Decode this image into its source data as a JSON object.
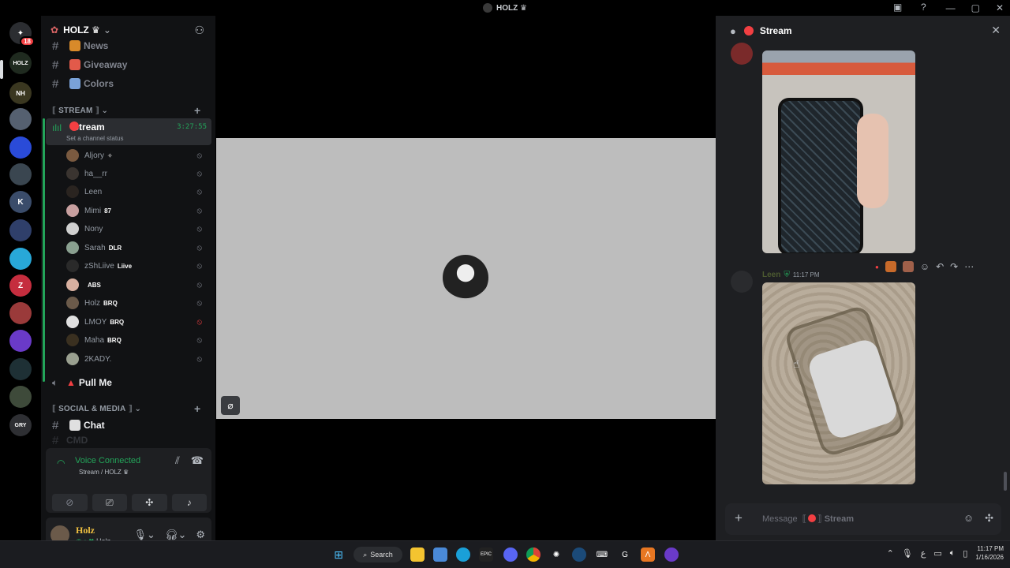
{
  "window": {
    "title": "HOLZ ♛",
    "controls": [
      "—",
      "▢",
      "✕"
    ]
  },
  "rail": {
    "home_badge": "18",
    "servers": [
      {
        "name": "discord-home",
        "label": "✦",
        "color": "#2b2d31"
      },
      {
        "name": "holz",
        "label": "HOLZ",
        "color": "#1f2a1f"
      },
      {
        "name": "nh",
        "label": "NH",
        "color": "#3a3720"
      },
      {
        "name": "server-3",
        "label": "",
        "color": "#556070"
      },
      {
        "name": "server-4",
        "label": "",
        "color": "#2a4bd8"
      },
      {
        "name": "server-5",
        "label": "",
        "color": "#3a4650"
      },
      {
        "name": "server-6",
        "label": "K",
        "color": "#3a4c6a"
      },
      {
        "name": "server-7",
        "label": "",
        "color": "#2f3f6a"
      },
      {
        "name": "server-8",
        "label": "",
        "color": "#28a8d8"
      },
      {
        "name": "server-9",
        "label": "Z",
        "color": "#c52d3e"
      },
      {
        "name": "server-10",
        "label": "",
        "color": "#9a3a3a"
      },
      {
        "name": "server-11",
        "label": "",
        "color": "#6a3ac8"
      },
      {
        "name": "server-12",
        "label": "",
        "color": "#1e3035"
      },
      {
        "name": "server-13",
        "label": "",
        "color": "#3e4a3a"
      },
      {
        "name": "server-14",
        "label": "GRY",
        "color": "#2e2f33"
      }
    ]
  },
  "guild": {
    "name": "HOLZ ♛",
    "channels_top": [
      {
        "label": "News"
      },
      {
        "label": "Giveaway"
      },
      {
        "label": "Colors"
      }
    ],
    "category_stream": "STREAM",
    "voice_channel": {
      "name": "Stream",
      "status": "Set a channel status",
      "time": "3:27:55"
    },
    "voice_users": [
      {
        "name": "Aljory",
        "tag": "✧"
      },
      {
        "name": "ha__rr",
        "tag": ""
      },
      {
        "name": "Leen",
        "tag": ""
      },
      {
        "name": "Mimi",
        "tag": "87"
      },
      {
        "name": "Nony",
        "tag": ""
      },
      {
        "name": "Sarah",
        "tag": "DLR"
      },
      {
        "name": "zShLiive",
        "tag": "Liive"
      },
      {
        "name": "",
        "tag": "ABS"
      },
      {
        "name": "Holz",
        "tag": "BRQ"
      },
      {
        "name": "LMOY",
        "tag": "BRQ"
      },
      {
        "name": "Maha",
        "tag": "BRQ"
      },
      {
        "name": "2KADY.",
        "tag": ""
      }
    ],
    "pull_me": "Pull Me",
    "category_social": "SOCIAL & MEDIA",
    "chat_channel": "Chat",
    "cmd_channel": "CMD"
  },
  "voice_panel": {
    "title": "Voice Connected",
    "sub": "Stream / HOLZ ♛"
  },
  "user": {
    "name": "Holz",
    "status": "Holz"
  },
  "chat": {
    "title": "Stream",
    "message_author": "Leen",
    "message_time": "11:17 PM",
    "composer_placeholder": "Message",
    "composer_channel": "Stream"
  },
  "taskbar": {
    "search_label": "Search",
    "time": "11:17 PM",
    "date": "1/16/2026"
  }
}
